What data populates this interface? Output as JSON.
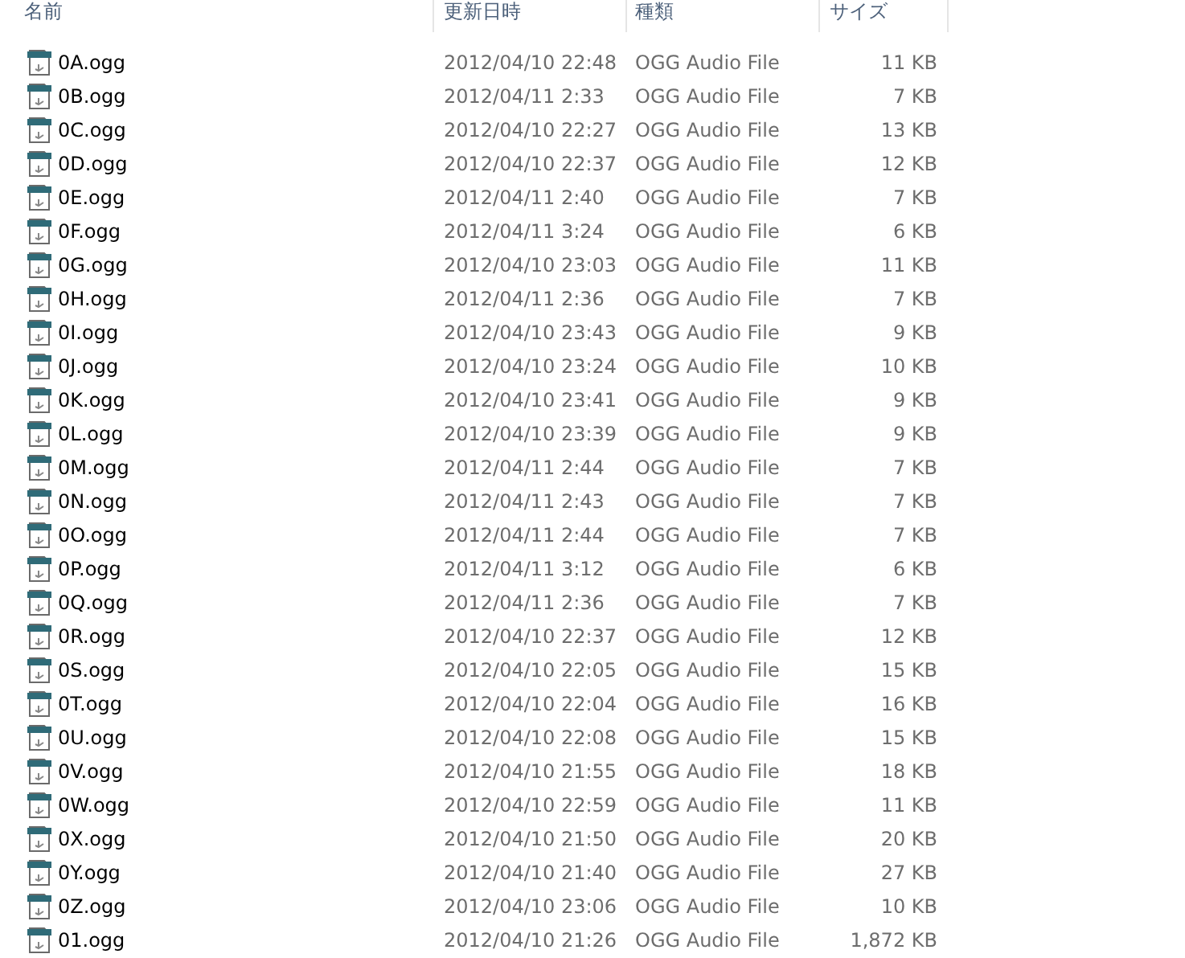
{
  "columns": [
    "名前",
    "更新日時",
    "種類",
    "サイズ"
  ],
  "rows": [
    {
      "name": "0A.ogg",
      "date": "2012/04/10 22:48",
      "type": "OGG Audio File",
      "size": "11 KB"
    },
    {
      "name": "0B.ogg",
      "date": "2012/04/11 2:33",
      "type": "OGG Audio File",
      "size": "7 KB"
    },
    {
      "name": "0C.ogg",
      "date": "2012/04/10 22:27",
      "type": "OGG Audio File",
      "size": "13 KB"
    },
    {
      "name": "0D.ogg",
      "date": "2012/04/10 22:37",
      "type": "OGG Audio File",
      "size": "12 KB"
    },
    {
      "name": "0E.ogg",
      "date": "2012/04/11 2:40",
      "type": "OGG Audio File",
      "size": "7 KB"
    },
    {
      "name": "0F.ogg",
      "date": "2012/04/11 3:24",
      "type": "OGG Audio File",
      "size": "6 KB"
    },
    {
      "name": "0G.ogg",
      "date": "2012/04/10 23:03",
      "type": "OGG Audio File",
      "size": "11 KB"
    },
    {
      "name": "0H.ogg",
      "date": "2012/04/11 2:36",
      "type": "OGG Audio File",
      "size": "7 KB"
    },
    {
      "name": "0I.ogg",
      "date": "2012/04/10 23:43",
      "type": "OGG Audio File",
      "size": "9 KB"
    },
    {
      "name": "0J.ogg",
      "date": "2012/04/10 23:24",
      "type": "OGG Audio File",
      "size": "10 KB"
    },
    {
      "name": "0K.ogg",
      "date": "2012/04/10 23:41",
      "type": "OGG Audio File",
      "size": "9 KB"
    },
    {
      "name": "0L.ogg",
      "date": "2012/04/10 23:39",
      "type": "OGG Audio File",
      "size": "9 KB"
    },
    {
      "name": "0M.ogg",
      "date": "2012/04/11 2:44",
      "type": "OGG Audio File",
      "size": "7 KB"
    },
    {
      "name": "0N.ogg",
      "date": "2012/04/11 2:43",
      "type": "OGG Audio File",
      "size": "7 KB"
    },
    {
      "name": "0O.ogg",
      "date": "2012/04/11 2:44",
      "type": "OGG Audio File",
      "size": "7 KB"
    },
    {
      "name": "0P.ogg",
      "date": "2012/04/11 3:12",
      "type": "OGG Audio File",
      "size": "6 KB"
    },
    {
      "name": "0Q.ogg",
      "date": "2012/04/11 2:36",
      "type": "OGG Audio File",
      "size": "7 KB"
    },
    {
      "name": "0R.ogg",
      "date": "2012/04/10 22:37",
      "type": "OGG Audio File",
      "size": "12 KB"
    },
    {
      "name": "0S.ogg",
      "date": "2012/04/10 22:05",
      "type": "OGG Audio File",
      "size": "15 KB"
    },
    {
      "name": "0T.ogg",
      "date": "2012/04/10 22:04",
      "type": "OGG Audio File",
      "size": "16 KB"
    },
    {
      "name": "0U.ogg",
      "date": "2012/04/10 22:08",
      "type": "OGG Audio File",
      "size": "15 KB"
    },
    {
      "name": "0V.ogg",
      "date": "2012/04/10 21:55",
      "type": "OGG Audio File",
      "size": "18 KB"
    },
    {
      "name": "0W.ogg",
      "date": "2012/04/10 22:59",
      "type": "OGG Audio File",
      "size": "11 KB"
    },
    {
      "name": "0X.ogg",
      "date": "2012/04/10 21:50",
      "type": "OGG Audio File",
      "size": "20 KB"
    },
    {
      "name": "0Y.ogg",
      "date": "2012/04/10 21:40",
      "type": "OGG Audio File",
      "size": "27 KB"
    },
    {
      "name": "0Z.ogg",
      "date": "2012/04/10 23:06",
      "type": "OGG Audio File",
      "size": "10 KB"
    },
    {
      "name": "01.ogg",
      "date": "2012/04/10 21:26",
      "type": "OGG Audio File",
      "size": "1,872 KB"
    }
  ]
}
